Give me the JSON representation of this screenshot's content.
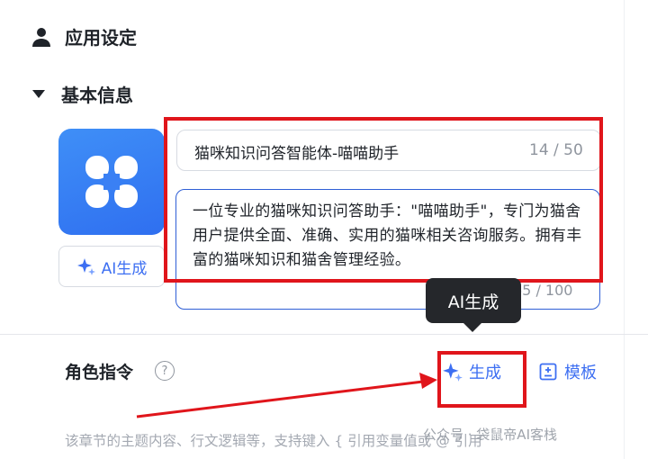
{
  "settings": {
    "title": "应用设定",
    "basic_info_label": "基本信息"
  },
  "app_name": {
    "value": "猫咪知识问答智能体-喵喵助手",
    "count": "14 / 50"
  },
  "description": {
    "value": "一位专业的猫咪知识问答助手：\"喵喵助手\"，专门为猫舍用户提供全面、准确、实用的猫咪相关咨询服务。拥有丰富的猫咪知识和猫舍管理经验。",
    "count": "65 / 100"
  },
  "avatar": {
    "icon": "four-petal-logo-icon",
    "ai_generate_label": "AI生成"
  },
  "tooltip": {
    "text": "AI生成"
  },
  "role": {
    "label": "角色指令",
    "generate_label": "生成",
    "template_label": "模板",
    "placeholder": "该章节的主题内容、行文逻辑等，支持键入 { 引用变量值或 @ 引用"
  },
  "watermark": "公众号 · 袋鼠帝AI客栈",
  "colors": {
    "accent": "#3d6ff2",
    "highlight_red": "#e0151b",
    "tooltip_bg": "#25272b"
  }
}
